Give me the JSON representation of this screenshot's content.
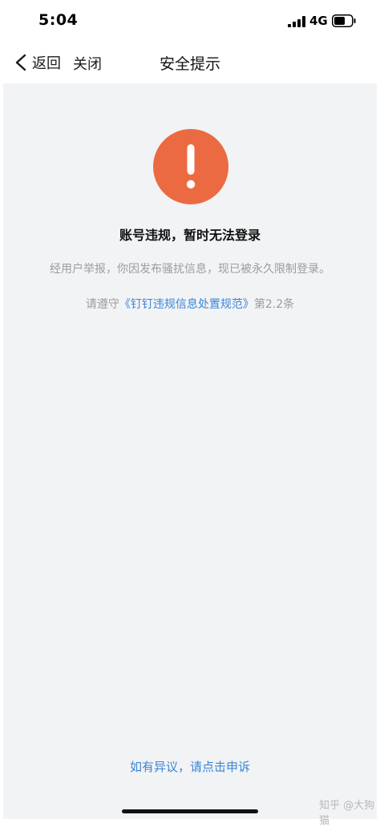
{
  "status_bar": {
    "time": "5:04",
    "network": "4G",
    "signal_icon": "cellular-signal-icon",
    "battery_icon": "battery-icon"
  },
  "nav": {
    "back_label": "返回",
    "close_label": "关闭",
    "title": "安全提示",
    "back_icon": "chevron-left-icon"
  },
  "notice": {
    "icon": "exclamation-warning-icon",
    "icon_color": "#ec6a42",
    "headline": "账号违规，暂时无法登录",
    "description": "经用户举报，你因发布骚扰信息，现已被永久限制登录。",
    "rule_prefix": "请遵守",
    "rule_link": "《钉钉违规信息处置规范》",
    "rule_suffix": "第2.2条",
    "link_color": "#3a86d6"
  },
  "appeal": {
    "label": "如有异议，请点击申诉"
  },
  "watermark": "知乎 @大狗猫"
}
